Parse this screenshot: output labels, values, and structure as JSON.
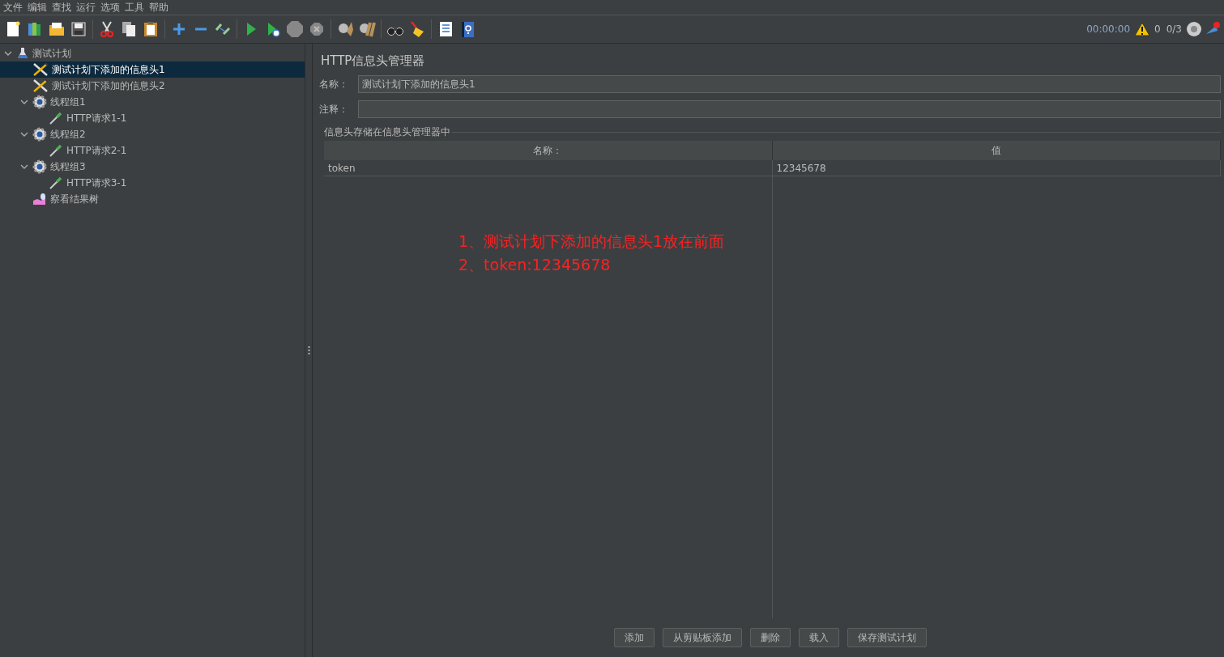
{
  "menu_bar": [
    "文件",
    "编辑",
    "查找",
    "运行",
    "选项",
    "工具",
    "帮助"
  ],
  "status": {
    "timer": "00:00:00",
    "warnings": "0",
    "threads": "0/3"
  },
  "tree": [
    {
      "label": "测试计划",
      "kind": "test-plan",
      "expanded": true,
      "selected": false,
      "children": [
        {
          "label": "测试计划下添加的信息头1",
          "kind": "header-manager",
          "selected": true
        },
        {
          "label": "测试计划下添加的信息头2",
          "kind": "header-manager",
          "selected": false
        },
        {
          "label": "线程组1",
          "kind": "thread-group",
          "expanded": true,
          "selected": false,
          "children": [
            {
              "label": "HTTP请求1-1",
              "kind": "http-request",
              "selected": false
            }
          ]
        },
        {
          "label": "线程组2",
          "kind": "thread-group",
          "expanded": true,
          "selected": false,
          "children": [
            {
              "label": "HTTP请求2-1",
              "kind": "http-request",
              "selected": false
            }
          ]
        },
        {
          "label": "线程组3",
          "kind": "thread-group",
          "expanded": true,
          "selected": false,
          "children": [
            {
              "label": "HTTP请求3-1",
              "kind": "http-request",
              "selected": false
            }
          ]
        },
        {
          "label": "察看结果树",
          "kind": "listener",
          "selected": false
        }
      ]
    }
  ],
  "panel": {
    "title": "HTTP信息头管理器",
    "name_field": {
      "label": "名称：",
      "value": "测试计划下添加的信息头1"
    },
    "comment_field": {
      "label": "注释："
    },
    "group_title": "信息头存储在信息头管理器中",
    "table": {
      "columns": [
        "名称：",
        "值"
      ],
      "rows": [
        [
          "token",
          "12345678"
        ]
      ]
    },
    "annotation": [
      "1、测试计划下添加的信息头1放在前面",
      "2、token:12345678"
    ],
    "buttons": [
      "添加",
      "从剪贴板添加",
      "删除",
      "载入",
      "保存测试计划"
    ]
  }
}
